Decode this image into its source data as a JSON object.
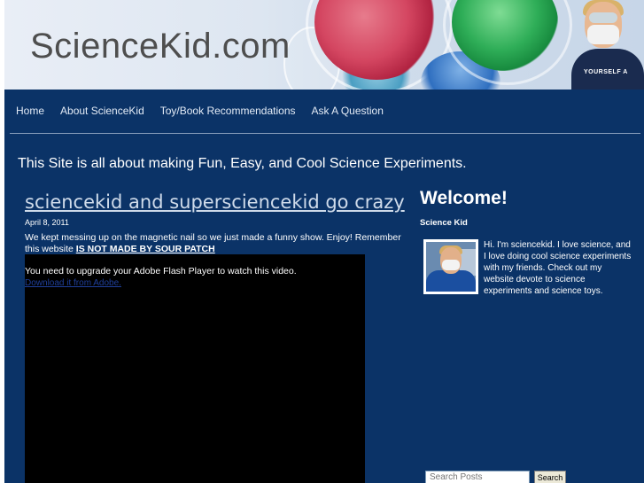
{
  "header": {
    "site_title": "ScienceKid.com",
    "shirt_text": "YOURSELF A"
  },
  "nav": {
    "items": [
      {
        "label": "Home"
      },
      {
        "label": "About ScienceKid"
      },
      {
        "label": "Toy/Book Recommendations"
      },
      {
        "label": "Ask A Question"
      }
    ]
  },
  "tagline": "This Site is all about making Fun, Easy, and Cool Science Experiments.",
  "post": {
    "title": "sciencekid and supersciencekid go crazy",
    "date": "April 8, 2011",
    "body_text": "We kept messing up on the magnetic nail so we just made a funny show. Enjoy! Remember this website ",
    "body_link": "IS NOT MADE BY SOUR PATCH",
    "video": {
      "flash_message": "You need to upgrade your Adobe Flash Player to watch this video.",
      "flash_link": "Download it from Adobe."
    }
  },
  "sidebar": {
    "welcome": "Welcome!",
    "subtitle": "Science Kid",
    "bio": "Hi. I'm sciencekid. I love science, and I love doing cool science experiments with my friends. Check out my website devote to science experiments and science toys.",
    "search": {
      "placeholder": "Search Posts",
      "button_label": "Search"
    }
  },
  "colors": {
    "page_background": "#0b3367",
    "nav_text": "#e3ebf6",
    "title_link": "#cfdbea"
  }
}
